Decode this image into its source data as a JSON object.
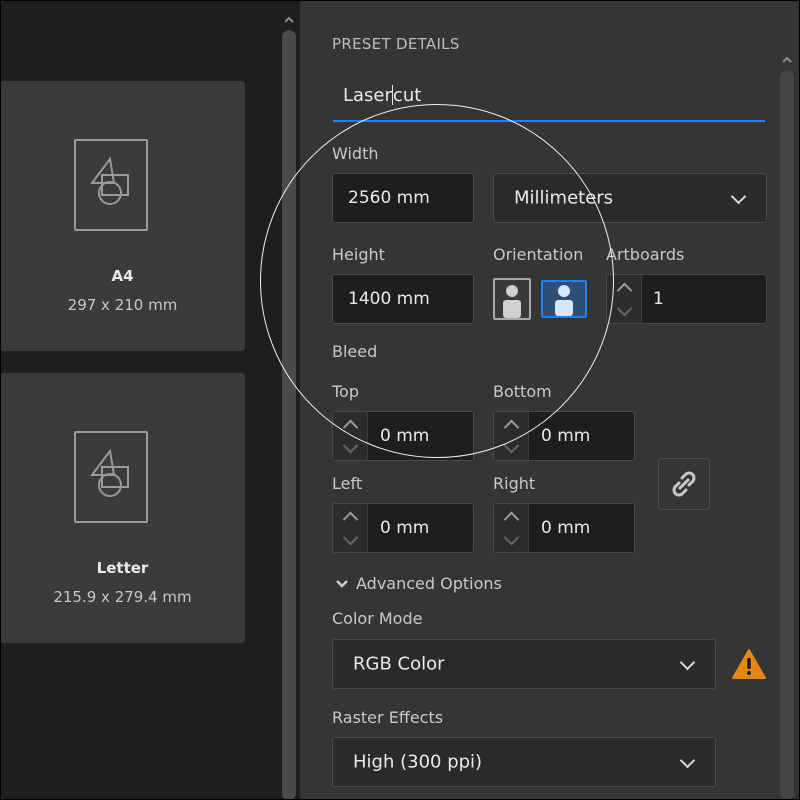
{
  "presets": [
    {
      "name": "A4",
      "size": "297 x 210 mm"
    },
    {
      "name": "Letter",
      "size": "215.9 x 279.4 mm"
    }
  ],
  "panel": {
    "heading": "PRESET DETAILS",
    "preset_name_before": "Laser",
    "preset_name_after": "cut",
    "width_label": "Width",
    "width_value": "2560 mm",
    "units_value": "Millimeters",
    "height_label": "Height",
    "height_value": "1400 mm",
    "orientation_label": "Orientation",
    "artboards_label": "Artboards",
    "artboards_value": "1",
    "bleed_label": "Bleed",
    "bleed": {
      "top_label": "Top",
      "top_value": "0 mm",
      "bottom_label": "Bottom",
      "bottom_value": "0 mm",
      "left_label": "Left",
      "left_value": "0 mm",
      "right_label": "Right",
      "right_value": "0 mm"
    },
    "advanced_label": "Advanced Options",
    "color_mode_label": "Color Mode",
    "color_mode_value": "RGB Color",
    "raster_label": "Raster Effects",
    "raster_value": "High (300 ppi)"
  },
  "colors": {
    "accent": "#2680eb",
    "warning": "#e68619",
    "panel_bg": "#353535"
  }
}
